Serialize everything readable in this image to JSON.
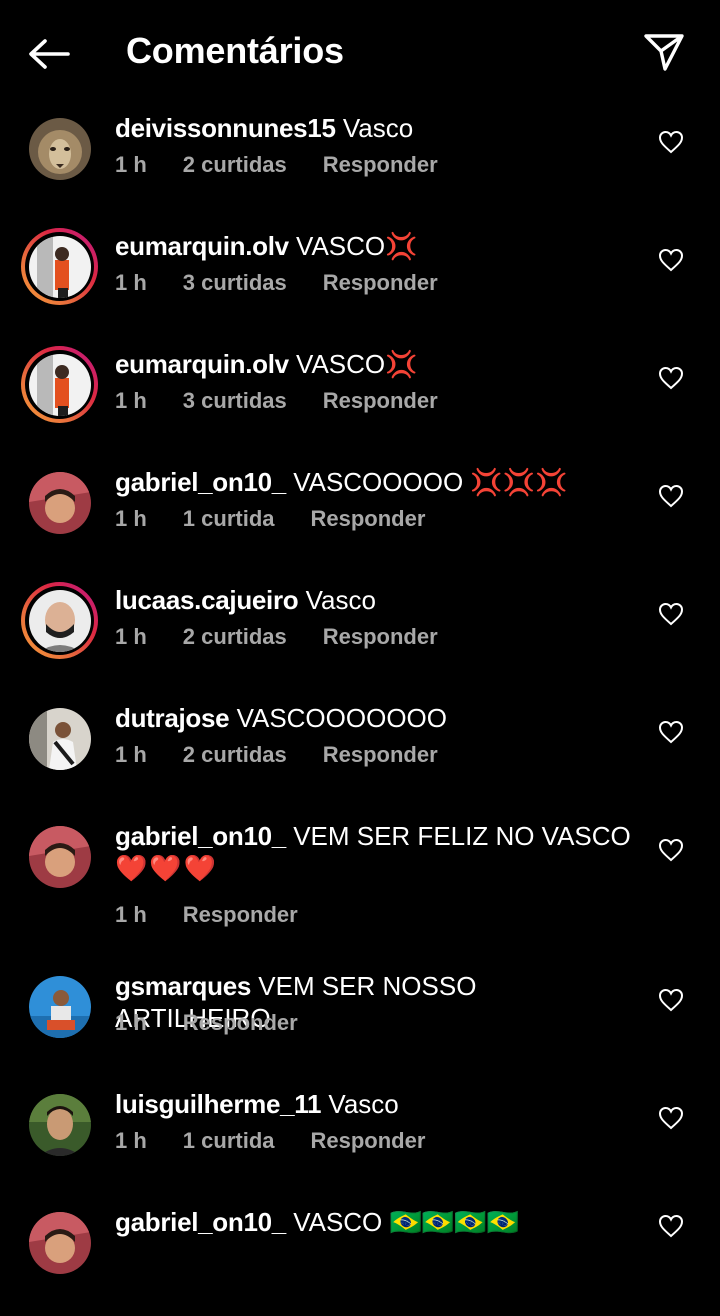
{
  "header": {
    "title": "Comentários"
  },
  "comments": [
    {
      "username": "deivissonnunes15",
      "text": "Vasco",
      "time": "1 h",
      "likes": "2 curtidas",
      "reply": "Responder"
    },
    {
      "username": "eumarquin.olv",
      "text": "VASCO💢",
      "time": "1 h",
      "likes": "3 curtidas",
      "reply": "Responder"
    },
    {
      "username": "eumarquin.olv",
      "text": "VASCO💢",
      "time": "1 h",
      "likes": "3 curtidas",
      "reply": "Responder"
    },
    {
      "username": "gabriel_on10_",
      "text": "VASCOOOOO 💢💢💢",
      "time": "1 h",
      "likes": "1 curtida",
      "reply": "Responder"
    },
    {
      "username": "lucaas.cajueiro",
      "text": "Vasco",
      "time": "1 h",
      "likes": "2 curtidas",
      "reply": "Responder"
    },
    {
      "username": "dutrajose",
      "text": "VASCOOOOOOO",
      "time": "1 h",
      "likes": "2 curtidas",
      "reply": "Responder"
    },
    {
      "username": "gabriel_on10_",
      "text": "VEM SER FELIZ NO VASCO",
      "text2": "❤️❤️❤️",
      "time": "1 h",
      "likes": "",
      "reply": "Responder"
    },
    {
      "username": "gsmarques",
      "text": "VEM SER NOSSO ARTILHEIRO",
      "time": "1 h",
      "likes": "",
      "reply": "Responder"
    },
    {
      "username": "luisguilherme_11",
      "text": "Vasco",
      "time": "1 h",
      "likes": "1 curtida",
      "reply": "Responder"
    },
    {
      "username": "gabriel_on10_",
      "text": "VASCO 🇧🇷🇧🇷🇧🇷🇧🇷",
      "time": "",
      "likes": "",
      "reply": ""
    }
  ],
  "icons": {
    "back": "arrow-left-icon",
    "send": "paper-plane-icon",
    "like": "heart-outline-icon"
  },
  "colors": {
    "background": "#000000",
    "text": "#ffffff",
    "meta": "#a8a8a8",
    "story_ring": "#dc2743"
  }
}
